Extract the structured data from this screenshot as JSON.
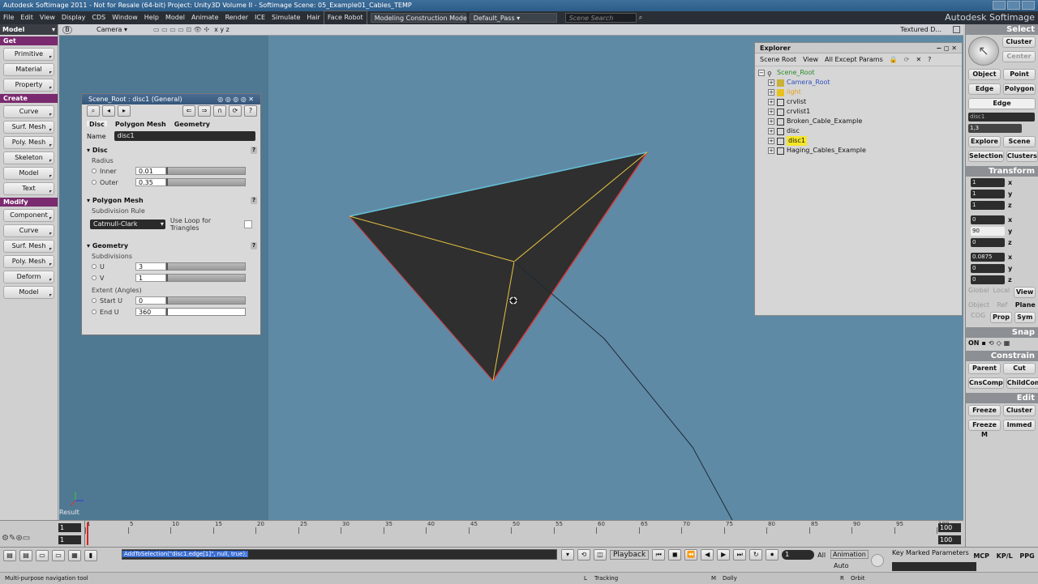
{
  "titlebar": {
    "text": "Autodesk Softimage 2011 - Not for Resale (64-bit)   Project: Unity3D Volume II - Softimage   Scene: 05_Example01_Cables_TEMP"
  },
  "menubar": {
    "items": [
      "File",
      "Edit",
      "View",
      "Display",
      "CDS",
      "Window",
      "Help",
      "Model",
      "Animate",
      "Render",
      "ICE",
      "Simulate",
      "Hair",
      "Face Robot"
    ],
    "construction_mode": "Modeling Construction Mode",
    "pass": "Default_Pass",
    "search_placeholder": "Scene Search",
    "brand": "Autodesk Softimage"
  },
  "leftpanel": {
    "mode": "Model",
    "sections": [
      {
        "title": "Get",
        "items": [
          "Primitive",
          "Material",
          "Property"
        ]
      },
      {
        "title": "Create",
        "items": [
          "Curve",
          "Surf. Mesh",
          "Poly. Mesh",
          "Skeleton",
          "Model",
          "Text"
        ]
      },
      {
        "title": "Modify",
        "items": [
          "Component",
          "Curve",
          "Surf. Mesh",
          "Poly. Mesh",
          "Deform",
          "Model"
        ]
      }
    ]
  },
  "viewport": {
    "view_letter": "B",
    "camera": "Camera",
    "axis_tools": "x y z",
    "display_mode": "Textured D...",
    "result_label": "Result"
  },
  "property_editor": {
    "title": "Scene_Root : disc1 (General)",
    "tabs": [
      "Disc",
      "Polygon Mesh",
      "Geometry"
    ],
    "name_label": "Name",
    "name_value": "disc1",
    "disc": {
      "header": "Disc",
      "radius_label": "Radius",
      "inner_label": "Inner",
      "inner_value": "0.01",
      "outer_label": "Outer",
      "outer_value": "0.35"
    },
    "polymesh": {
      "header": "Polygon Mesh",
      "subdiv_rule_label": "Subdivision Rule",
      "subdiv_rule_value": "Catmull-Clark",
      "loop_label": "Use Loop for Triangles"
    },
    "geometry": {
      "header": "Geometry",
      "subdivisions_label": "Subdivisions",
      "u_label": "U",
      "u_value": "3",
      "v_label": "V",
      "v_value": "1",
      "extent_label": "Extent (Angles)",
      "start_label": "Start U",
      "start_value": "0",
      "end_label": "End U",
      "end_value": "360"
    }
  },
  "explorer": {
    "title": "Explorer",
    "scope": "Scene Root",
    "view": "View",
    "filter": "All Except Params",
    "root": "Scene_Root",
    "nodes": [
      "Camera_Root",
      "light",
      "crvlist",
      "crvlist1",
      "Broken_Cable_Example",
      "disc",
      "disc1",
      "Haging_Cables_Example"
    ]
  },
  "mcp": {
    "select_header": "Select",
    "cluster": "Cluster",
    "center": "Center",
    "object": "Object",
    "point": "Point",
    "edge": "Edge",
    "polygon": "Polygon",
    "edge_active": "Edge",
    "selection_name": "disc1",
    "selection_count": "1,3",
    "explore": "Explore",
    "scene": "Scene",
    "selection": "Selection",
    "clusters": "Clusters",
    "transform_header": "Transform",
    "scale": [
      "1",
      "1",
      "1"
    ],
    "rotate": [
      "0",
      "90",
      "0"
    ],
    "translate": [
      "0.0875",
      "0",
      "0"
    ],
    "axes": [
      "x",
      "y",
      "z"
    ],
    "global": "Global",
    "local": "Local",
    "view": "View",
    "object_ref": "Object",
    "ref": "Ref",
    "plane": "Plane",
    "cog": "COG",
    "prop": "Prop",
    "sym": "Sym",
    "snap_header": "Snap",
    "snap_on": "ON",
    "constrain_header": "Constrain",
    "parent": "Parent",
    "cut": "Cut",
    "cnscomp": "CnsComp",
    "childcomp": "ChildComp",
    "edit_header": "Edit",
    "freeze": "Freeze",
    "cluster2": "Cluster",
    "freeze_m": "Freeze M",
    "immed": "Immed"
  },
  "timeline": {
    "start": "1",
    "current": "1",
    "end": "100",
    "end2": "100",
    "ticks": [
      "1",
      "5",
      "10",
      "15",
      "20",
      "25",
      "30",
      "35",
      "40",
      "45",
      "50",
      "55",
      "60",
      "65",
      "70",
      "75",
      "80",
      "85",
      "90",
      "95",
      "100"
    ]
  },
  "bottombar": {
    "command": "AddToSelection(\"disc1.edge[1]\", null, true);",
    "playback": "Playback",
    "frame": "1",
    "all": "All",
    "animation": "Animation",
    "auto": "Auto",
    "key_params": "Key Marked Parameters",
    "mcp_tab": "MCP",
    "kp_tab": "KP/L",
    "ppg_tab": "PPG",
    "status": "Multi-purpose navigation tool",
    "l_label": "L",
    "tracking": "Tracking",
    "m_label": "M",
    "dolly": "Dolly",
    "r_label": "R",
    "orbit": "Orbit"
  },
  "colors": {
    "viewport_bg": "#5f8aa6",
    "mesh_fill": "#2f2f2f",
    "edge_highlight": "#e6c240",
    "selection_yellow": "#f5e62a",
    "section_purple": "#7a2a6e"
  }
}
